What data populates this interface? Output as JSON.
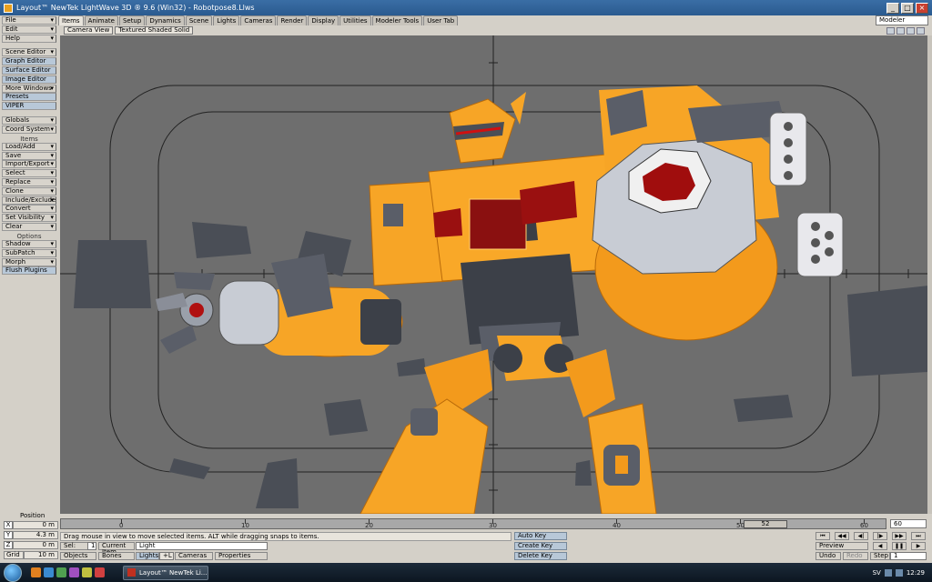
{
  "window": {
    "title": "Layout™ NewTek LightWave 3D ® 9.6  (Win32) - Robotpose8.Llws",
    "mode_select": "Modeler",
    "min_label": "_",
    "max_label": "□",
    "close_label": "×"
  },
  "tabs": [
    "Items",
    "Animate",
    "Setup",
    "Dynamics",
    "Scene",
    "Lights",
    "Cameras",
    "Render",
    "Display",
    "Utilities",
    "Modeler Tools",
    "User Tab"
  ],
  "left_panel": {
    "group1": [
      "File",
      "Edit",
      "Help"
    ],
    "group2": [
      "Scene Editor",
      "Graph Editor",
      "Surface Editor",
      "Image Editor",
      "More Windows",
      "Presets",
      "VIPER"
    ],
    "group3": [
      "Globals",
      "Coord System"
    ],
    "items_header": "Items",
    "items": [
      "Load/Add",
      "Save",
      "Import/Export",
      "Select",
      "Replace",
      "Clone",
      "Include/Exclude",
      "Convert",
      "Set Visibility",
      "Clear"
    ],
    "options_header": "Options",
    "options": [
      "Shadow",
      "SubPatch",
      "Morph",
      "Flush Plugins"
    ]
  },
  "viewport": {
    "view_select": "Camera View",
    "render_mode": "Textured Shaded Solid"
  },
  "timeline": {
    "position_label": "Position",
    "ticks": [
      "0",
      "10",
      "20",
      "30",
      "40",
      "50",
      "60"
    ],
    "current_frame": "52",
    "end_frame": "60"
  },
  "coords": {
    "x": {
      "axis": "X",
      "value": "0 m"
    },
    "y": {
      "axis": "Y",
      "value": "4.3 m"
    },
    "z": {
      "axis": "Z",
      "value": "0 m"
    },
    "grid": {
      "label": "Grid",
      "value": "10 m"
    }
  },
  "status": {
    "help_text": "Drag mouse in view to move selected items. ALT while dragging snaps to items.",
    "sel_label": "Sel:",
    "sel_value": "1",
    "current_item_label": "Current Item",
    "current_item_value": "Light",
    "objects": "Objects",
    "bones": "Bones",
    "lights": "Lights",
    "lights_shortcut": "+L",
    "cameras": "Cameras",
    "properties": "Properties",
    "auto_key": "Auto Key",
    "create_key": "Create Key",
    "delete_key": "Delete Key",
    "preview": "Preview",
    "undo": "Undo",
    "redo": "Redo",
    "step_label": "Step",
    "step_value": "1"
  },
  "taskbar": {
    "task_label": "Layout™ NewTek Li...",
    "lang": "SV",
    "clock": "12:29"
  }
}
